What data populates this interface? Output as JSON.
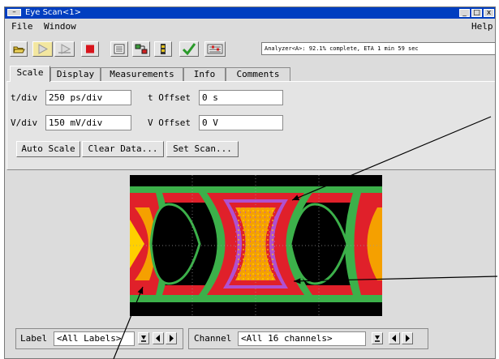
{
  "window": {
    "title": "Eye Scan<1>",
    "system_menu_glyph": "–",
    "minimize_glyph": "_",
    "maximize_glyph": "□",
    "close_glyph": "x"
  },
  "menubar": {
    "file": "File",
    "window": "Window",
    "help": "Help"
  },
  "toolbar": {
    "icons": [
      "open-folder-icon",
      "run-icon",
      "run-repetitive-icon",
      "stop-icon",
      "listing-icon",
      "config-icon",
      "chip-icon",
      "check-icon",
      "settings-icon"
    ],
    "status_text": "Analyzer<A>:  92.1% complete, ETA 1 min 59 sec"
  },
  "tabs": {
    "scale": "Scale",
    "display": "Display",
    "measurements": "Measurements",
    "info": "Info",
    "comments": "Comments"
  },
  "scale": {
    "tdiv_label": "t/div",
    "tdiv_value": "250 ps/div",
    "toffset_label": "t Offset",
    "toffset_value": "0 s",
    "vdiv_label": "V/div",
    "vdiv_value": "150 mV/div",
    "voffset_label": "V Offset",
    "voffset_value": "0 V"
  },
  "buttons": {
    "auto_scale": "Auto Scale",
    "clear_data": "Clear Data...",
    "set_scan": "Set Scan..."
  },
  "bottom": {
    "label_caption": "Label",
    "label_value": "<All Labels>",
    "channel_caption": "Channel",
    "channel_value": "<All 16 channels>"
  },
  "colors": {
    "title_bar": "#003ec0",
    "eye_red": "#e0202a",
    "eye_orange": "#f5a000",
    "eye_green": "#3cb04a",
    "eye_purple": "#b050d0",
    "eye_background": "#000000"
  }
}
